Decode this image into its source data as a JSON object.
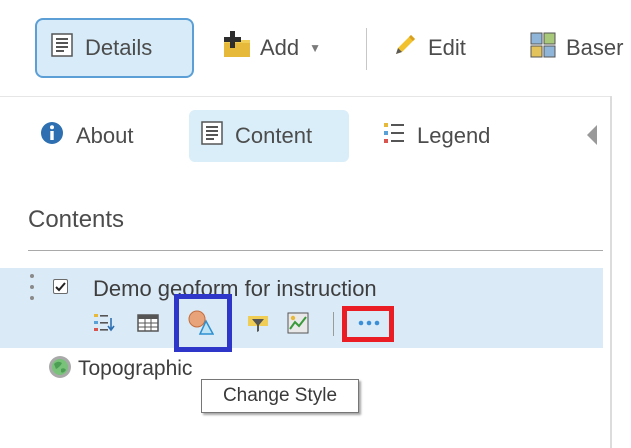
{
  "toolbar": {
    "details_label": "Details",
    "add_label": "Add",
    "edit_label": "Edit",
    "basemap_label": "Baser"
  },
  "tabs": [
    {
      "label": "About",
      "icon": "info-icon"
    },
    {
      "label": "Content",
      "icon": "content-list-icon"
    },
    {
      "label": "Legend",
      "icon": "legend-icon"
    }
  ],
  "contents": {
    "title": "Contents",
    "layers": [
      {
        "name": "Demo geoform for instruction",
        "checked": true
      }
    ],
    "basemap": {
      "name": "Topographic"
    }
  },
  "tooltip": {
    "text": "Change Style"
  },
  "colors": {
    "selected_bg": "#dbeaf7",
    "details_border": "#5b9fd6",
    "highlight_blue": "#2d36c8",
    "highlight_red": "#ea1c24"
  }
}
